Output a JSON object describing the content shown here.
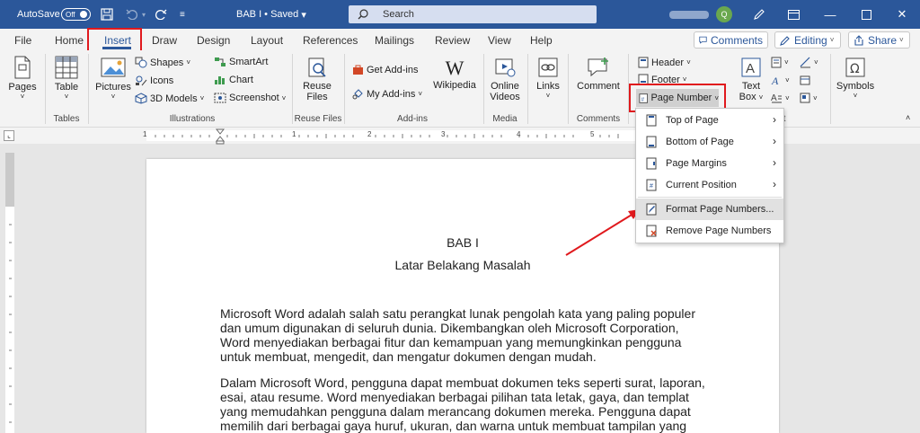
{
  "titlebar": {
    "autosave_label": "AutoSave",
    "autosave_state": "Off",
    "doc_title": "BAB I • Saved",
    "search_placeholder": "Search",
    "avatar_initial": "Q"
  },
  "tabs": [
    "File",
    "Home",
    "Insert",
    "Draw",
    "Design",
    "Layout",
    "References",
    "Mailings",
    "Review",
    "View",
    "Help"
  ],
  "active_tab": "Insert",
  "actions": {
    "comments": "Comments",
    "editing": "Editing",
    "share": "Share"
  },
  "ribbon": {
    "pages": "Pages",
    "table": "Table",
    "pictures": "Pictures",
    "shapes": "Shapes",
    "icons": "Icons",
    "models3d": "3D Models",
    "smartart": "SmartArt",
    "chart": "Chart",
    "screenshot": "Screenshot",
    "reuse_files_1": "Reuse",
    "reuse_files_2": "Files",
    "get_addins": "Get Add-ins",
    "my_addins": "My Add-ins",
    "wikipedia": "Wikipedia",
    "online_videos_1": "Online",
    "online_videos_2": "Videos",
    "links": "Links",
    "comment": "Comment",
    "header": "Header",
    "footer": "Footer",
    "page_number": "Page Number",
    "text_box_1": "Text",
    "text_box_2": "Box",
    "symbols": "Symbols",
    "groups": {
      "tables": "Tables",
      "illustrations": "Illustrations",
      "reuse_files": "Reuse Files",
      "addins": "Add-ins",
      "media": "Media",
      "comments": "Comments",
      "text_partial": "t"
    }
  },
  "menu": {
    "items": [
      {
        "label": "Top of Page",
        "submenu": true
      },
      {
        "label": "Bottom of Page",
        "submenu": true
      },
      {
        "label": "Page Margins",
        "submenu": true
      },
      {
        "label": "Current Position",
        "submenu": true
      },
      {
        "label": "Format Page Numbers...",
        "submenu": false,
        "highlighted": true
      },
      {
        "label": "Remove Page Numbers",
        "submenu": false
      }
    ]
  },
  "ruler": {
    "marks": [
      "1",
      "1",
      "2",
      "3",
      "4",
      "5"
    ]
  },
  "document": {
    "title": "BAB I",
    "subtitle": "Latar Belakang Masalah",
    "p1": [
      "Microsoft Word adalah salah satu perangkat lunak pengolah kata yang paling populer",
      "dan umum digunakan di seluruh dunia. Dikembangkan oleh Microsoft Corporation,",
      "Word menyediakan berbagai fitur dan kemampuan yang memungkinkan pengguna",
      "untuk membuat, mengedit, dan mengatur dokumen dengan mudah."
    ],
    "p2": [
      "Dalam Microsoft Word, pengguna dapat membuat dokumen teks seperti surat, laporan,",
      "esai, atau resume. Word menyediakan berbagai pilihan tata letak, gaya, dan templat",
      "yang memudahkan pengguna dalam merancang dokumen mereka. Pengguna dapat",
      "memilih dari berbagai gaya huruf, ukuran, dan warna untuk membuat tampilan yang"
    ]
  },
  "colors": {
    "accent": "#2b579a",
    "highlight_box": "#e0191d",
    "arrow": "#e0191d"
  }
}
